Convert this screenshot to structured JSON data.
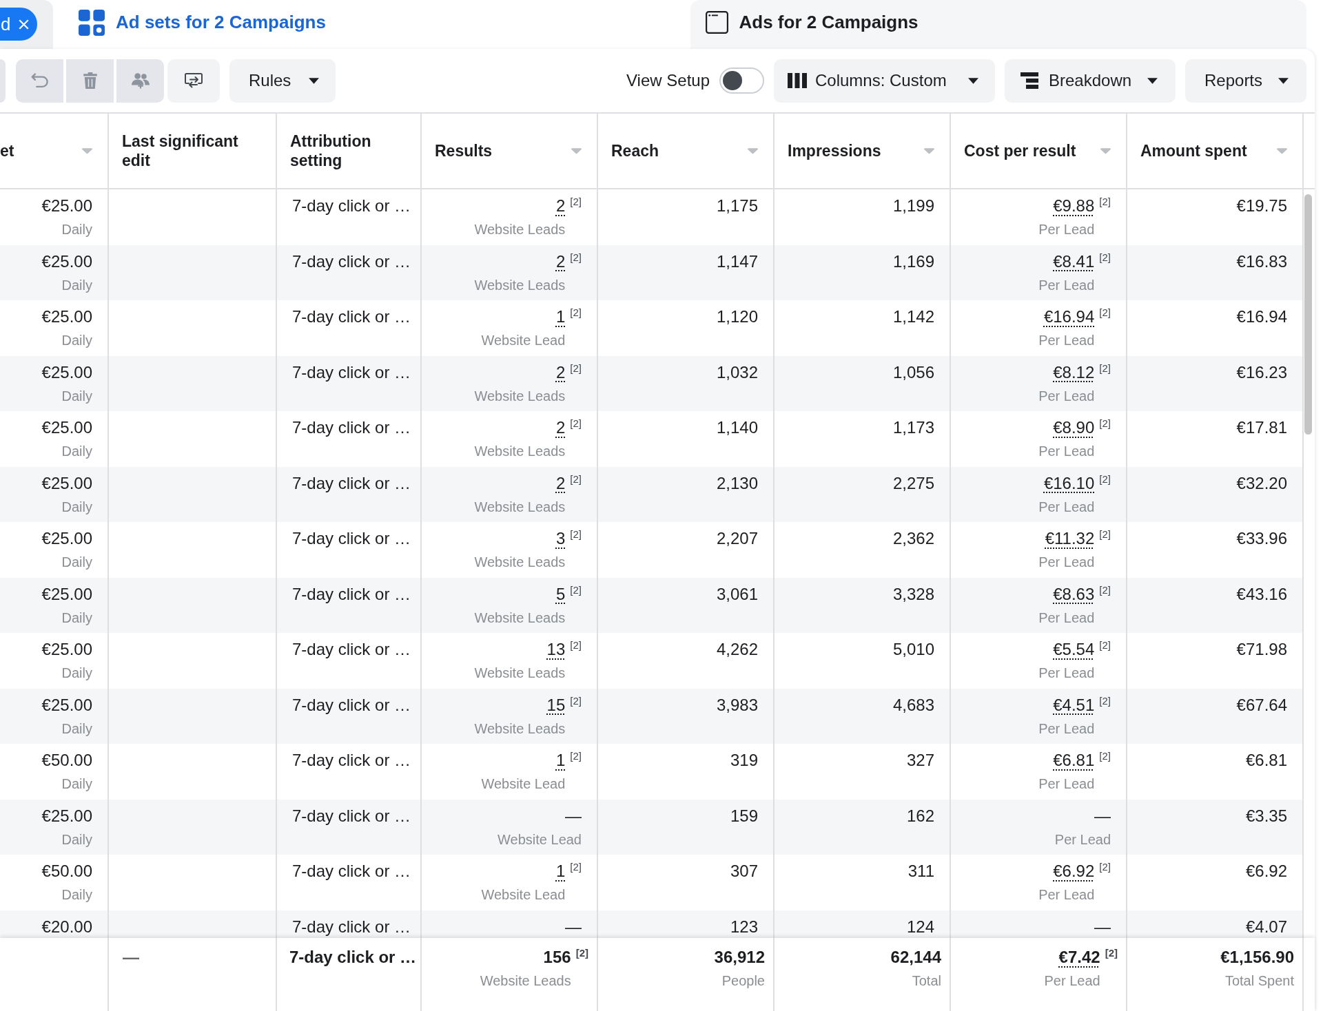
{
  "tabs": [
    {
      "kind": "filter",
      "label": "d",
      "selected": false
    },
    {
      "kind": "adsets",
      "label": "Ad sets for 2 Campaigns",
      "selected": true
    },
    {
      "kind": "ads",
      "label": "Ads for 2 Campaigns",
      "selected": false
    }
  ],
  "toolbar": {
    "icon_buttons": [
      {
        "kind": "undo",
        "disabled": true
      },
      {
        "kind": "delete",
        "disabled": true
      },
      {
        "kind": "audience",
        "disabled": true
      },
      {
        "kind": "export",
        "disabled": false
      }
    ],
    "rules": {
      "label": "Rules"
    },
    "view_setup": {
      "label": "View Setup",
      "on": false
    },
    "columns": {
      "label": "Columns: Custom"
    },
    "breakdown": {
      "label": "Breakdown"
    },
    "reports": {
      "label": "Reports"
    }
  },
  "table": {
    "columns": [
      {
        "label": "et",
        "sortable": true
      },
      {
        "label": "Last significant edit",
        "sortable": false
      },
      {
        "label": "Attribution setting",
        "sortable": false
      },
      {
        "label": "Results",
        "sortable": true
      },
      {
        "label": "Reach",
        "sortable": true
      },
      {
        "label": "Impressions",
        "sortable": true
      },
      {
        "label": "Cost per result",
        "sortable": true
      },
      {
        "label": "Amount spent",
        "sortable": true
      }
    ],
    "rows": [
      {
        "column_1": {
          "value": "€25.00",
          "sub": "Daily"
        },
        "attribution_setting": {
          "value": "7-day click or …"
        },
        "results": {
          "value": "2",
          "note": "[2]",
          "underlined": true,
          "sub": "Website Leads"
        },
        "reach": {
          "value": "1,175"
        },
        "impressions": {
          "value": "1,199"
        },
        "cost_per_result": {
          "value": "€9.88",
          "note": "[2]",
          "underlined": true,
          "sub": "Per Lead"
        },
        "amount_spent": {
          "value": "€19.75"
        }
      },
      {
        "column_1": {
          "value": "€25.00",
          "sub": "Daily"
        },
        "attribution_setting": {
          "value": "7-day click or …"
        },
        "results": {
          "value": "2",
          "note": "[2]",
          "underlined": true,
          "sub": "Website Leads"
        },
        "reach": {
          "value": "1,147"
        },
        "impressions": {
          "value": "1,169"
        },
        "cost_per_result": {
          "value": "€8.41",
          "note": "[2]",
          "underlined": true,
          "sub": "Per Lead"
        },
        "amount_spent": {
          "value": "€16.83"
        }
      },
      {
        "column_1": {
          "value": "€25.00",
          "sub": "Daily"
        },
        "attribution_setting": {
          "value": "7-day click or …"
        },
        "results": {
          "value": "1",
          "note": "[2]",
          "underlined": true,
          "sub": "Website Lead"
        },
        "reach": {
          "value": "1,120"
        },
        "impressions": {
          "value": "1,142"
        },
        "cost_per_result": {
          "value": "€16.94",
          "note": "[2]",
          "underlined": true,
          "sub": "Per Lead"
        },
        "amount_spent": {
          "value": "€16.94"
        }
      },
      {
        "column_1": {
          "value": "€25.00",
          "sub": "Daily"
        },
        "attribution_setting": {
          "value": "7-day click or …"
        },
        "results": {
          "value": "2",
          "note": "[2]",
          "underlined": true,
          "sub": "Website Leads"
        },
        "reach": {
          "value": "1,032"
        },
        "impressions": {
          "value": "1,056"
        },
        "cost_per_result": {
          "value": "€8.12",
          "note": "[2]",
          "underlined": true,
          "sub": "Per Lead"
        },
        "amount_spent": {
          "value": "€16.23"
        }
      },
      {
        "column_1": {
          "value": "€25.00",
          "sub": "Daily"
        },
        "attribution_setting": {
          "value": "7-day click or …"
        },
        "results": {
          "value": "2",
          "note": "[2]",
          "underlined": true,
          "sub": "Website Leads"
        },
        "reach": {
          "value": "1,140"
        },
        "impressions": {
          "value": "1,173"
        },
        "cost_per_result": {
          "value": "€8.90",
          "note": "[2]",
          "underlined": true,
          "sub": "Per Lead"
        },
        "amount_spent": {
          "value": "€17.81"
        }
      },
      {
        "column_1": {
          "value": "€25.00",
          "sub": "Daily"
        },
        "attribution_setting": {
          "value": "7-day click or …"
        },
        "results": {
          "value": "2",
          "note": "[2]",
          "underlined": true,
          "sub": "Website Leads"
        },
        "reach": {
          "value": "2,130"
        },
        "impressions": {
          "value": "2,275"
        },
        "cost_per_result": {
          "value": "€16.10",
          "note": "[2]",
          "underlined": true,
          "sub": "Per Lead"
        },
        "amount_spent": {
          "value": "€32.20"
        }
      },
      {
        "column_1": {
          "value": "€25.00",
          "sub": "Daily"
        },
        "attribution_setting": {
          "value": "7-day click or …"
        },
        "results": {
          "value": "3",
          "note": "[2]",
          "underlined": true,
          "sub": "Website Leads"
        },
        "reach": {
          "value": "2,207"
        },
        "impressions": {
          "value": "2,362"
        },
        "cost_per_result": {
          "value": "€11.32",
          "note": "[2]",
          "underlined": true,
          "sub": "Per Lead"
        },
        "amount_spent": {
          "value": "€33.96"
        }
      },
      {
        "column_1": {
          "value": "€25.00",
          "sub": "Daily"
        },
        "attribution_setting": {
          "value": "7-day click or …"
        },
        "results": {
          "value": "5",
          "note": "[2]",
          "underlined": true,
          "sub": "Website Leads"
        },
        "reach": {
          "value": "3,061"
        },
        "impressions": {
          "value": "3,328"
        },
        "cost_per_result": {
          "value": "€8.63",
          "note": "[2]",
          "underlined": true,
          "sub": "Per Lead"
        },
        "amount_spent": {
          "value": "€43.16"
        }
      },
      {
        "column_1": {
          "value": "€25.00",
          "sub": "Daily"
        },
        "attribution_setting": {
          "value": "7-day click or …"
        },
        "results": {
          "value": "13",
          "note": "[2]",
          "underlined": true,
          "sub": "Website Leads"
        },
        "reach": {
          "value": "4,262"
        },
        "impressions": {
          "value": "5,010"
        },
        "cost_per_result": {
          "value": "€5.54",
          "note": "[2]",
          "underlined": true,
          "sub": "Per Lead"
        },
        "amount_spent": {
          "value": "€71.98"
        }
      },
      {
        "column_1": {
          "value": "€25.00",
          "sub": "Daily"
        },
        "attribution_setting": {
          "value": "7-day click or …"
        },
        "results": {
          "value": "15",
          "note": "[2]",
          "underlined": true,
          "sub": "Website Leads"
        },
        "reach": {
          "value": "3,983"
        },
        "impressions": {
          "value": "4,683"
        },
        "cost_per_result": {
          "value": "€4.51",
          "note": "[2]",
          "underlined": true,
          "sub": "Per Lead"
        },
        "amount_spent": {
          "value": "€67.64"
        }
      },
      {
        "column_1": {
          "value": "€50.00",
          "sub": "Daily"
        },
        "attribution_setting": {
          "value": "7-day click or …"
        },
        "results": {
          "value": "1",
          "note": "[2]",
          "underlined": true,
          "sub": "Website Lead"
        },
        "reach": {
          "value": "319"
        },
        "impressions": {
          "value": "327"
        },
        "cost_per_result": {
          "value": "€6.81",
          "note": "[2]",
          "underlined": true,
          "sub": "Per Lead"
        },
        "amount_spent": {
          "value": "€6.81"
        }
      },
      {
        "column_1": {
          "value": "€25.00",
          "sub": "Daily"
        },
        "attribution_setting": {
          "value": "7-day click or …"
        },
        "results": {
          "value": "—",
          "sub": "Website Lead"
        },
        "reach": {
          "value": "159"
        },
        "impressions": {
          "value": "162"
        },
        "cost_per_result": {
          "value": "—",
          "sub": "Per Lead"
        },
        "amount_spent": {
          "value": "€3.35"
        }
      },
      {
        "column_1": {
          "value": "€50.00",
          "sub": "Daily"
        },
        "attribution_setting": {
          "value": "7-day click or …"
        },
        "results": {
          "value": "1",
          "note": "[2]",
          "underlined": true,
          "sub": "Website Lead"
        },
        "reach": {
          "value": "307"
        },
        "impressions": {
          "value": "311"
        },
        "cost_per_result": {
          "value": "€6.92",
          "note": "[2]",
          "underlined": true,
          "sub": "Per Lead"
        },
        "amount_spent": {
          "value": "€6.92"
        }
      },
      {
        "column_1": {
          "value": "€20.00"
        },
        "attribution_setting": {
          "value": "7-day click or …"
        },
        "results": {
          "value": "—"
        },
        "reach": {
          "value": "123"
        },
        "impressions": {
          "value": "124"
        },
        "cost_per_result": {
          "value": "—"
        },
        "amount_spent": {
          "value": "€4.07"
        }
      }
    ],
    "totals": {
      "last_significant_edit": {
        "value": "—"
      },
      "attribution_setting": {
        "value": "7-day click or …"
      },
      "results": {
        "value": "156",
        "note": "[2]",
        "underlined": false,
        "sub": "Website Leads"
      },
      "reach": {
        "value": "36,912",
        "sub": "People"
      },
      "impressions": {
        "value": "62,144",
        "sub": "Total"
      },
      "cost_per_result": {
        "value": "€7.42",
        "note": "[2]",
        "underlined": true,
        "sub": "Per Lead"
      },
      "amount_spent": {
        "value": "€1,156.90",
        "sub": "Total Spent"
      }
    }
  }
}
